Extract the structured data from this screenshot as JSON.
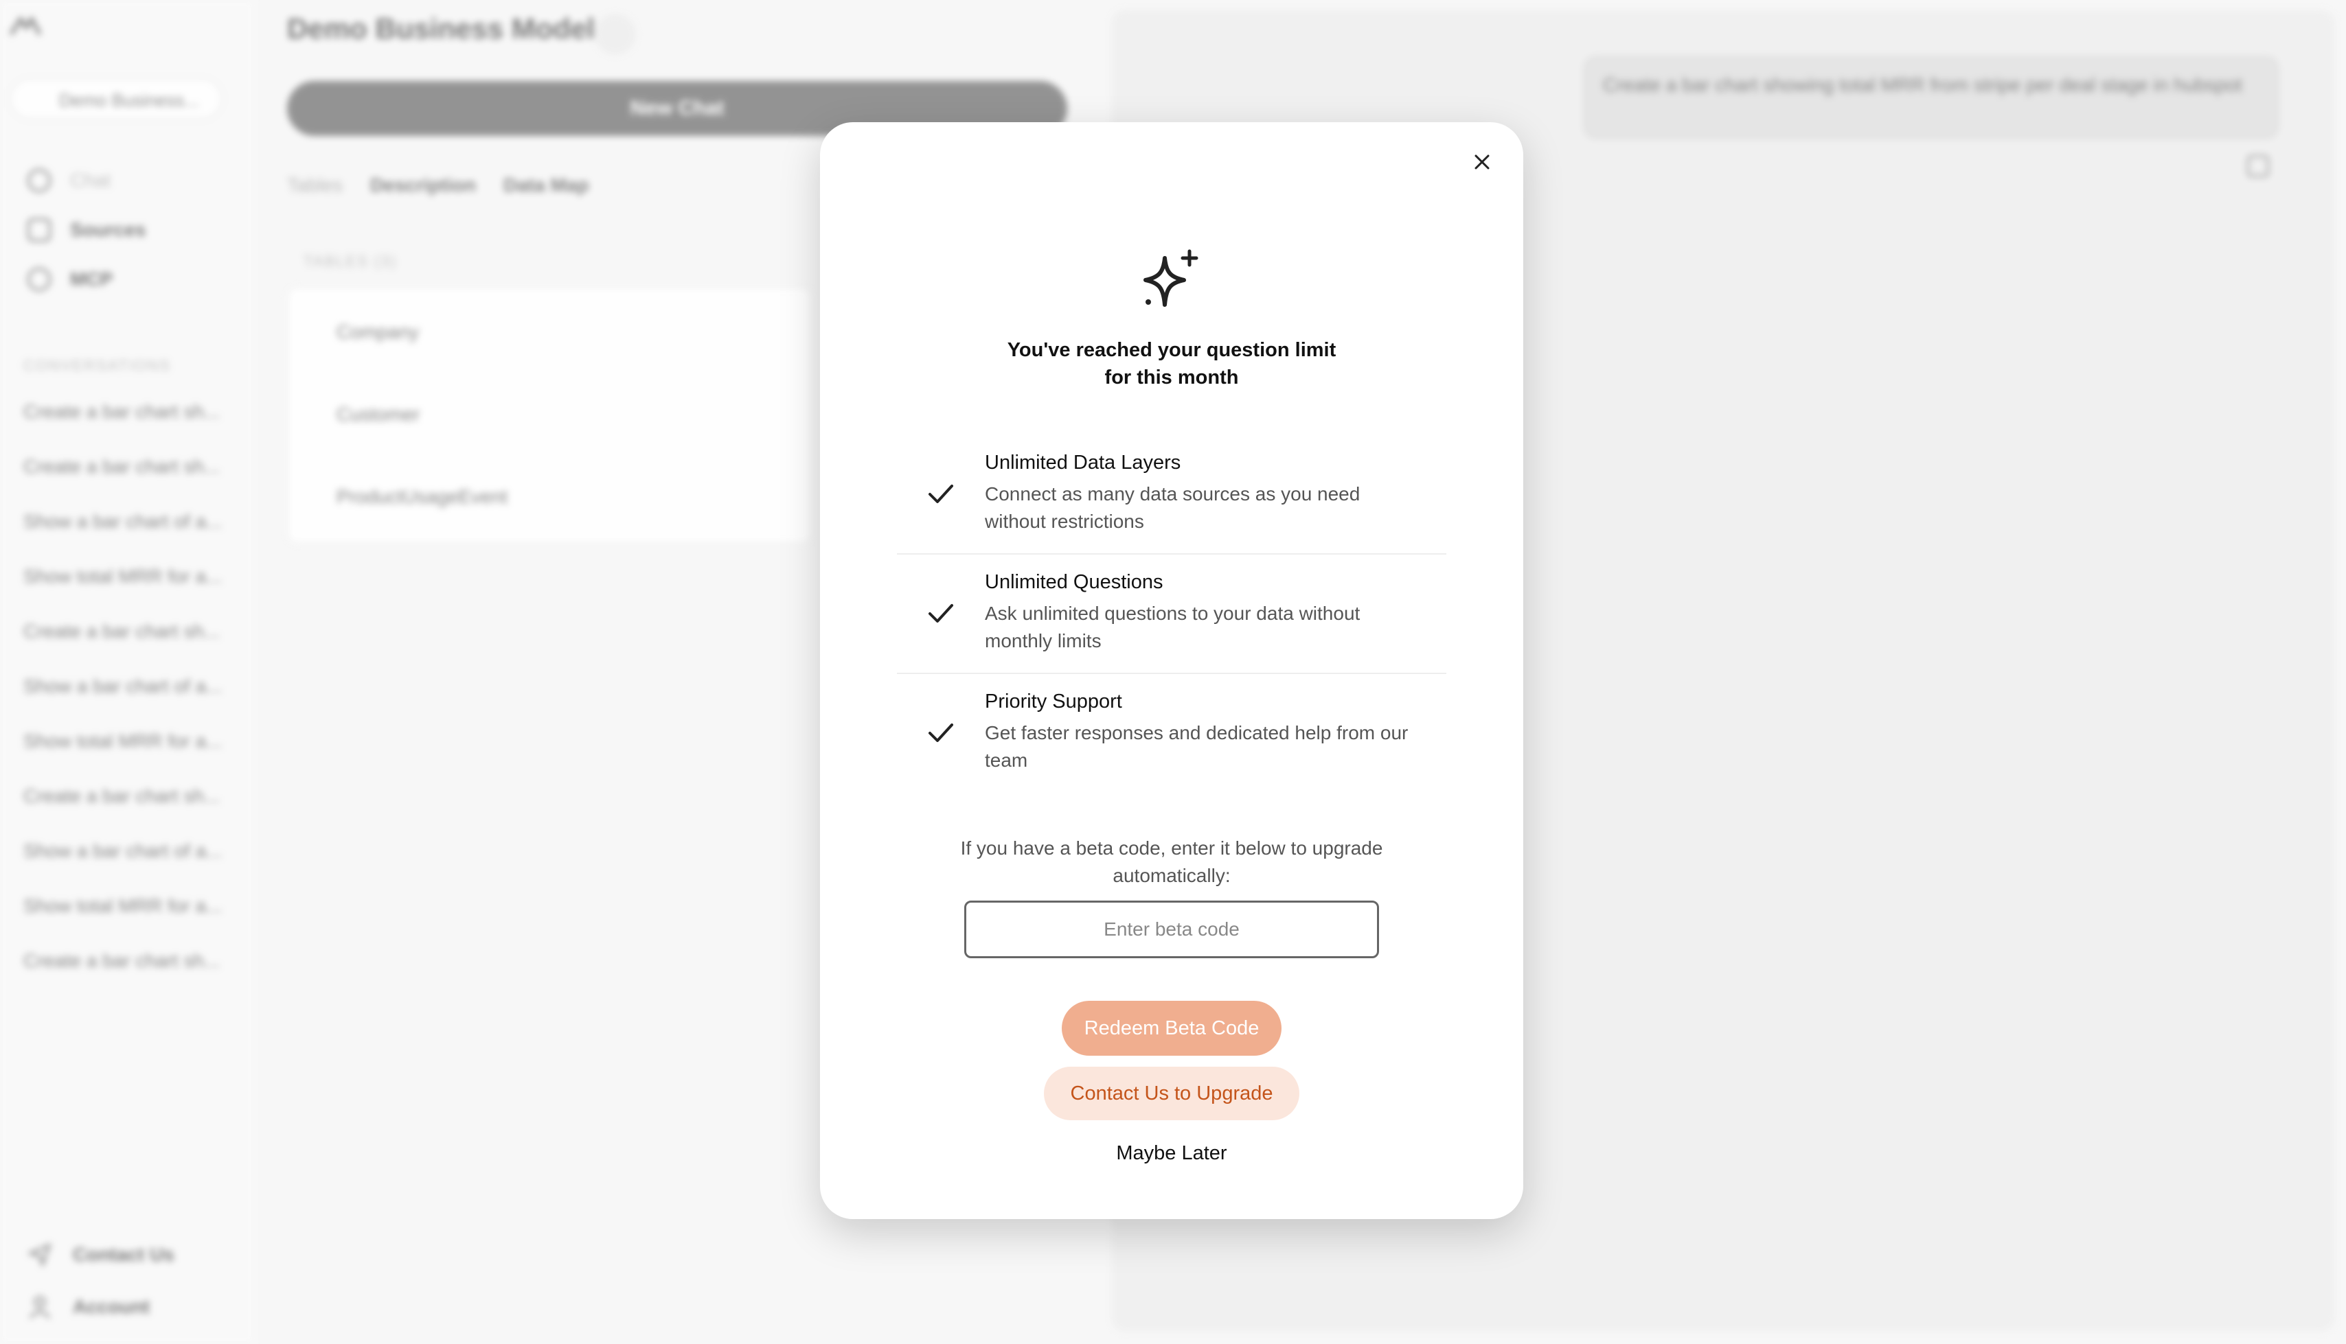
{
  "sidebar": {
    "model_select": "Demo Business...",
    "nav": [
      {
        "label": "Chat",
        "icon": "chat-icon"
      },
      {
        "label": "Sources",
        "icon": "database-icon"
      },
      {
        "label": "MCP",
        "icon": "plug-icon"
      }
    ],
    "conversations_label": "CONVERSATIONS",
    "conversations": [
      "Create a bar chart sh...",
      "Create a bar chart sh...",
      "Show a bar chart of a...",
      "Show total MRR for a...",
      "Create a bar chart sh...",
      "Show a bar chart of a...",
      "Show total MRR for a...",
      "Create a bar chart sh...",
      "Show a bar chart of a...",
      "Show total MRR for a...",
      "Create a bar chart sh..."
    ],
    "bottom": [
      {
        "label": "Contact Us",
        "icon": "send-icon"
      },
      {
        "label": "Account",
        "icon": "user-icon"
      }
    ]
  },
  "main": {
    "title": "Demo Business Model",
    "new_chat_label": "New Chat",
    "tabs": [
      {
        "label": "Tables",
        "active": false
      },
      {
        "label": "Description",
        "active": true
      },
      {
        "label": "Data Map",
        "active": true
      }
    ],
    "tables_label": "TABLES (3)",
    "tables": [
      "Company",
      "Customer",
      "ProductUsageEvent"
    ]
  },
  "chat": {
    "user_message": "Create a bar chart showing total MRR from stripe per deal stage in hubspot"
  },
  "modal": {
    "title_line1": "You've reached your question limit",
    "title_line2": "for this month",
    "features": [
      {
        "title": "Unlimited Data Layers",
        "desc": "Connect as many data sources as you need without restrictions"
      },
      {
        "title": "Unlimited Questions",
        "desc": "Ask unlimited questions to your data without monthly limits"
      },
      {
        "title": "Priority Support",
        "desc": "Get faster responses and dedicated help from our team"
      }
    ],
    "beta_note": "If you have a beta code, enter it below to upgrade automatically:",
    "beta_placeholder": "Enter beta code",
    "redeem_label": "Redeem Beta Code",
    "contact_label": "Contact Us to Upgrade",
    "later_label": "Maybe Later"
  },
  "colors": {
    "accent": "#f0ae8f",
    "accent_text": "#c4541a",
    "accent_light": "#fbe6dc"
  }
}
